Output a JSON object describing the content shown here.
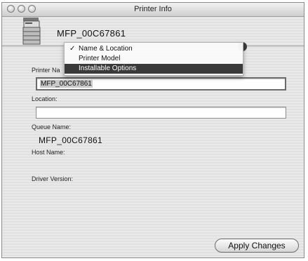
{
  "window": {
    "title": "Printer Info"
  },
  "printer": {
    "name": "MFP_00C67861"
  },
  "menu": {
    "items": [
      {
        "label": "Name & Location",
        "checked": true,
        "check": "✓"
      },
      {
        "label": "Printer Model",
        "checked": false
      },
      {
        "label": "Installable Options",
        "checked": false,
        "highlighted": true
      }
    ]
  },
  "form": {
    "printer_name_label": "Printer Na",
    "printer_name_value": "MFP_00C67861",
    "location_label": "Location:",
    "location_value": "",
    "queue_name_label": "Queue Name:",
    "queue_name_value": "MFP_00C67861",
    "host_name_label": "Host Name:",
    "driver_version_label": "Driver Version:"
  },
  "buttons": {
    "apply_label": "Apply Changes"
  }
}
